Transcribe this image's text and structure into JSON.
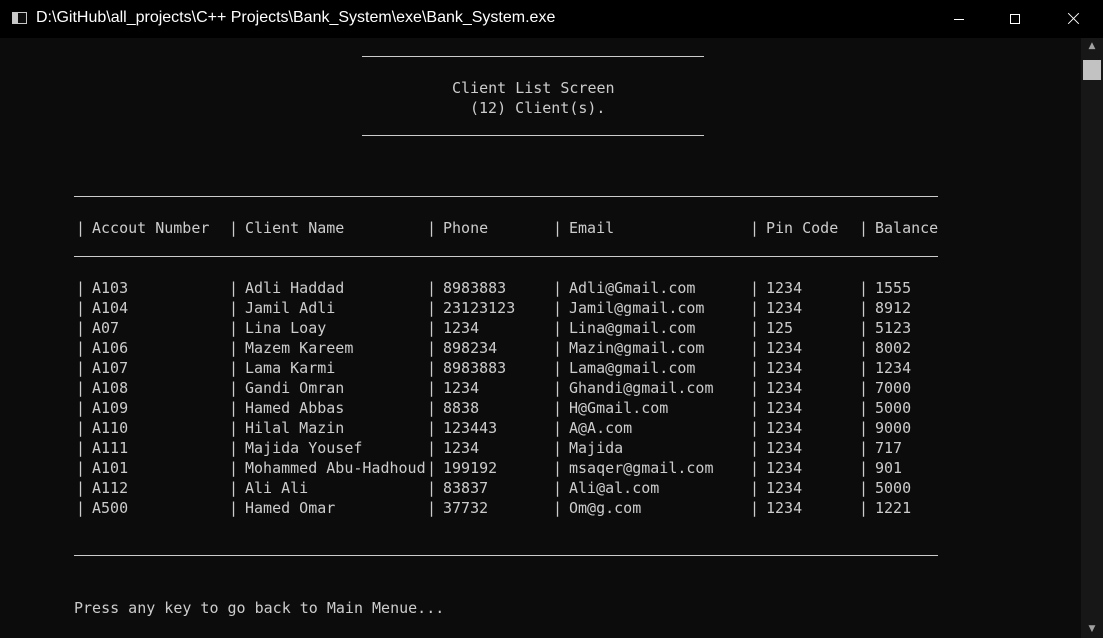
{
  "window": {
    "title": "D:\\GitHub\\all_projects\\C++ Projects\\Bank_System\\exe\\Bank_System.exe",
    "background": "#0c0c0c",
    "text_color": "#cccccc"
  },
  "header": {
    "title": "Client List Screen",
    "count": "(12) Client(s)."
  },
  "table": {
    "columns": [
      "Accout Number",
      "Client Name",
      "Phone",
      "Email",
      "Pin Code",
      "Balance"
    ],
    "rows": [
      [
        "A103",
        "Adli Haddad",
        "8983883",
        "Adli@Gmail.com",
        "1234",
        "1555"
      ],
      [
        "A104",
        "Jamil Adli",
        "23123123",
        "Jamil@gmail.com",
        "1234",
        "8912"
      ],
      [
        "A07",
        "Lina Loay",
        "1234",
        "Lina@gmail.com",
        "125",
        "5123"
      ],
      [
        "A106",
        "Mazem Kareem",
        "898234",
        "Mazin@gmail.com",
        "1234",
        "8002"
      ],
      [
        "A107",
        "Lama Karmi",
        "8983883",
        "Lama@gmail.com",
        "1234",
        "1234"
      ],
      [
        "A108",
        "Gandi Omran",
        "1234",
        "Ghandi@gmail.com",
        "1234",
        "7000"
      ],
      [
        "A109",
        "Hamed Abbas",
        "8838",
        "H@Gmail.com",
        "1234",
        "5000"
      ],
      [
        "A110",
        "Hilal Mazin",
        "123443",
        "A@A.com",
        "1234",
        "9000"
      ],
      [
        "A111",
        "Majida Yousef",
        "1234",
        "Majida",
        "1234",
        "717"
      ],
      [
        "A101",
        "Mohammed Abu-Hadhoud",
        "199192",
        "msaqer@gmail.com",
        "1234",
        "901"
      ],
      [
        "A112",
        "Ali Ali",
        "83837",
        "Ali@al.com",
        "1234",
        "5000"
      ],
      [
        "A500",
        "Hamed Omar",
        "37732",
        "Om@g.com",
        "1234",
        "1221"
      ]
    ]
  },
  "footer": {
    "prompt": "Press any key to go back to Main Menue..."
  },
  "icons": {
    "app": "console-window-icon",
    "minimize": "minimize-icon",
    "maximize": "maximize-icon",
    "close": "close-icon",
    "scroll_up": "scroll-up-arrow-icon",
    "scroll_down": "scroll-down-arrow-icon"
  }
}
